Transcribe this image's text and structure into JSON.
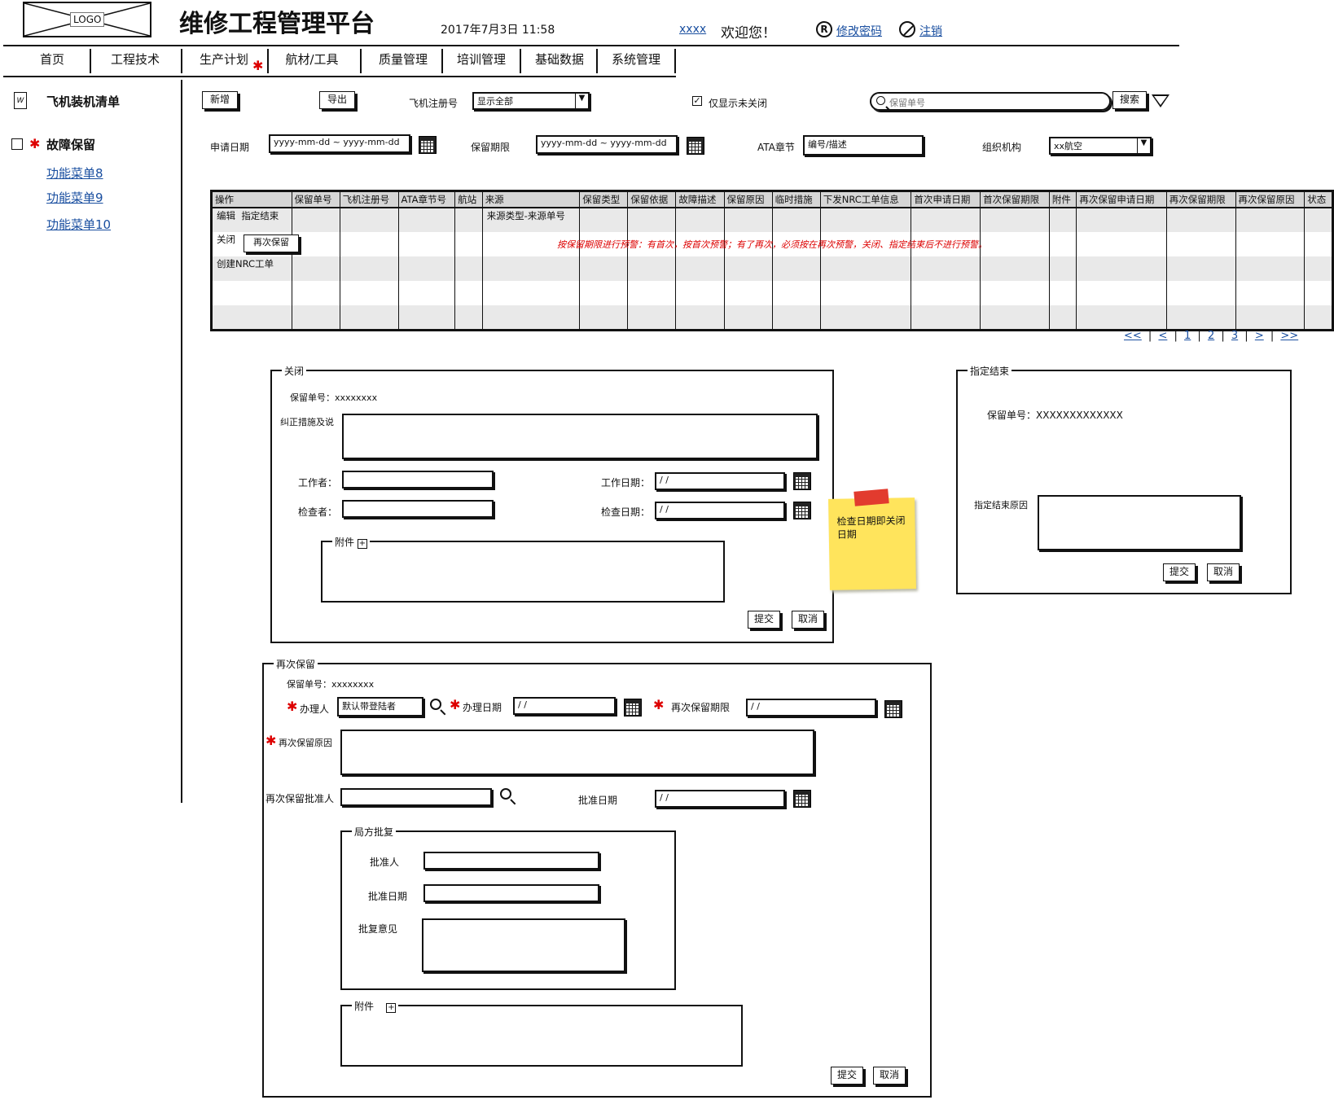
{
  "header": {
    "logo": "LOGO",
    "app_title": "维修工程管理平台",
    "datetime": "2017年7月3日 11:58",
    "user": "xxxx",
    "welcome": "欢迎您！",
    "change_password": "修改密码",
    "logout": "注销"
  },
  "nav": {
    "items": [
      "首页",
      "工程技术",
      "生产计划",
      "航材/工具",
      "质量管理",
      "培训管理",
      "基础数据",
      "系统管理"
    ]
  },
  "sidebar": {
    "items": [
      {
        "label": "飞机装机清单"
      },
      {
        "label": "故障保留"
      }
    ],
    "sub_items": [
      "功能菜单8",
      "功能菜单9",
      "功能菜单10"
    ]
  },
  "toolbar": {
    "add": "新增",
    "export": "导出",
    "reg_label": "飞机注册号",
    "reg_value": "显示全部",
    "only_open": "仅显示未关闭",
    "search_placeholder": "保留单号",
    "search_btn": "搜索"
  },
  "filters": {
    "apply_date_label": "申请日期",
    "apply_date_value": "yyyy-mm-dd ~ yyyy-mm-dd",
    "retain_label": "保留期限",
    "retain_value": "yyyy-mm-dd ~ yyyy-mm-dd",
    "ata_label": "ATA章节",
    "ata_value": "编号/描述",
    "org_label": "组织机构",
    "org_value": "xx航空"
  },
  "table": {
    "columns": [
      "操作",
      "保留单号",
      "飞机注册号",
      "ATA章节号",
      "航站",
      "来源",
      "保留类型",
      "保留依据",
      "故障描述",
      "保留原因",
      "临时措施",
      "下发NRC工单信息",
      "首次申请日期",
      "首次保留期限",
      "附件",
      "再次保留申请日期",
      "再次保留期限",
      "再次保留原因",
      "状态"
    ],
    "row1": {
      "edit": "编辑",
      "specify_end": "指定结束",
      "source": "来源类型-来源单号"
    },
    "row2": {
      "close": "关闭",
      "retain_again": "再次保留"
    },
    "row3": {
      "create_nrc": "创建NRC工单"
    },
    "warning": "按保留期限进行预警：有首次，按首次预警；有了再次，必须按在再次预警，关闭、指定结束后不进行预警。"
  },
  "pagination": {
    "items": [
      "<<",
      "<",
      "1",
      "2",
      "3",
      ">",
      ">>"
    ]
  },
  "close_form": {
    "title": "关闭",
    "order_no": "保留单号：xxxxxxxx",
    "corrective_label": "纠正措施及说",
    "worker_label": "工作者：",
    "work_date_label": "工作日期：",
    "work_date_value": "/ /",
    "inspector_label": "检查者：",
    "inspect_date_label": "检查日期：",
    "inspect_date_value": "/ /",
    "attachment_label": "附件",
    "submit": "提交",
    "cancel": "取消"
  },
  "sticky_note": {
    "text": "检查日期即关闭日期"
  },
  "end_form": {
    "title": "指定结束",
    "order_no": "保留单号：XXXXXXXXXXXXX",
    "reason_label": "指定结束原因",
    "submit": "提交",
    "cancel": "取消"
  },
  "retain_form": {
    "title": "再次保留",
    "order_no": "保留单号：xxxxxxxx",
    "handler_label": "办理人",
    "handler_value": "默认带登陆者",
    "handle_date_label": "办理日期",
    "handle_date_value": "/ /",
    "period_label": "再次保留期限",
    "period_value": "/ /",
    "reason_label": "再次保留原因",
    "approver_label": "再次保留批准人",
    "approve_date_label": "批准日期",
    "approve_date_value": "/ /",
    "bureau": {
      "title": "局方批复",
      "approver_label": "批准人",
      "date_label": "批准日期",
      "opinion_label": "批复意见"
    },
    "attachment_label": "附件",
    "submit": "提交",
    "cancel": "取消"
  }
}
